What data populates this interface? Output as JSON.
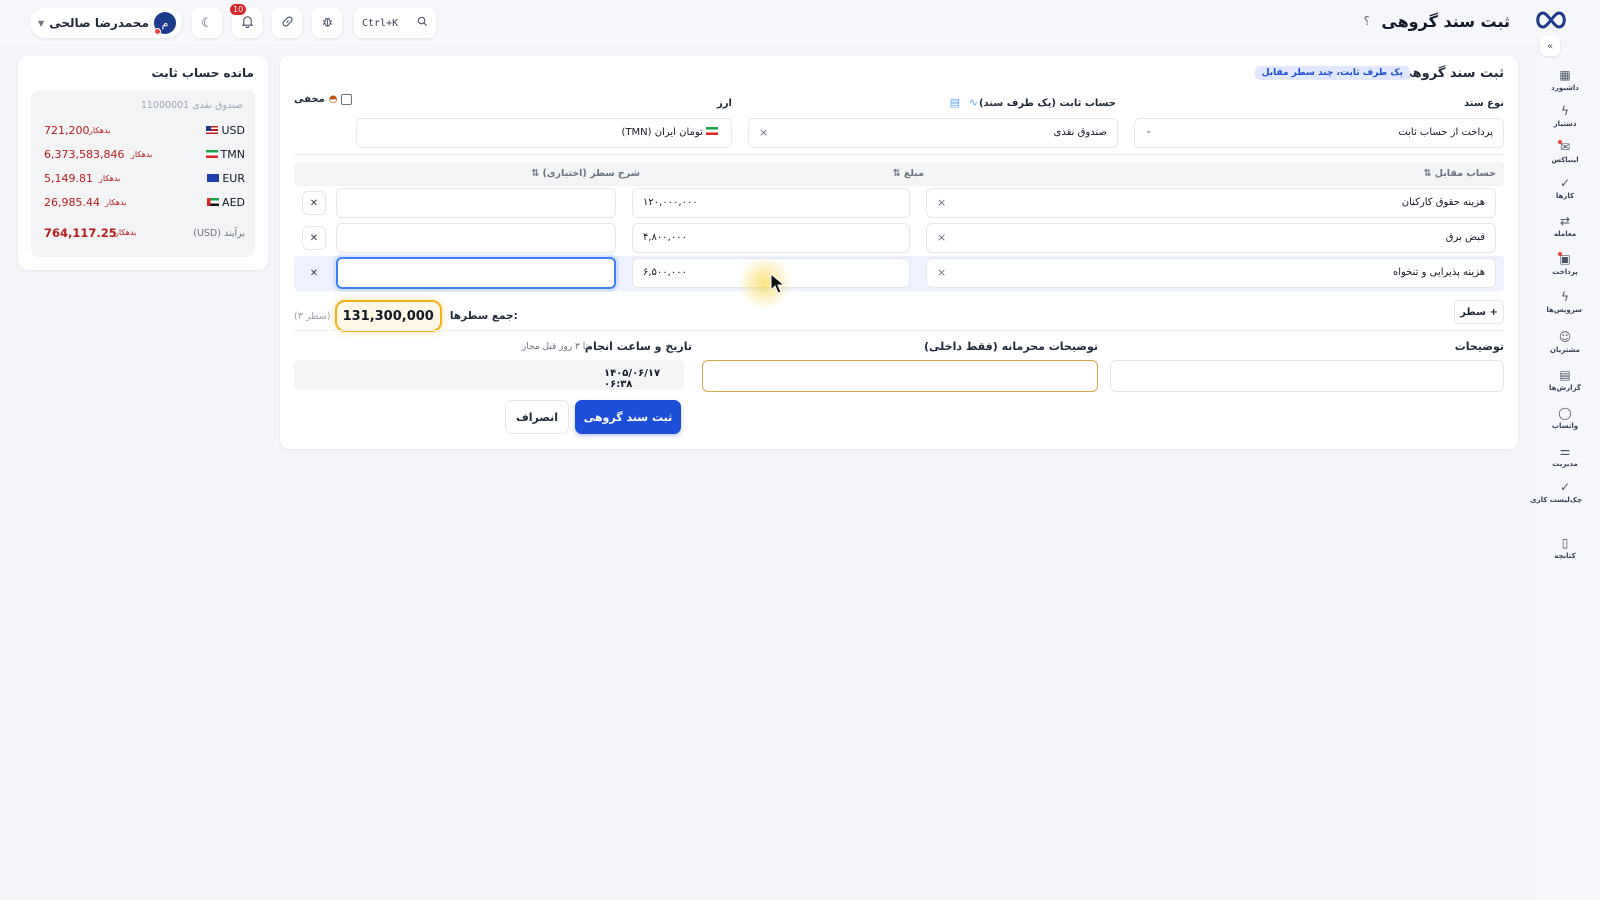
{
  "header": {
    "page_title": "ثبت سند گروهی",
    "help": "؟",
    "user_name": "محمدرضا صالحی",
    "avatar_letter": "م",
    "notification_count": "10",
    "search_shortcut": "Ctrl+K",
    "icons": [
      "moon-icon",
      "bell-icon",
      "link-icon",
      "bug-icon",
      "search-icon"
    ]
  },
  "sidebar": {
    "collapse": "«",
    "items": [
      {
        "label": "داشبورد",
        "icon": "grid-icon",
        "glyph": "▦"
      },
      {
        "label": "دستیار",
        "icon": "bolt-icon",
        "glyph": "ϟ"
      },
      {
        "label": "اینباکس",
        "icon": "inbox-icon",
        "glyph": "✉"
      },
      {
        "label": "کارها",
        "icon": "check-icon",
        "glyph": "✓"
      },
      {
        "label": "معامله",
        "icon": "swap-icon",
        "glyph": "⇄"
      },
      {
        "label": "پرداخت",
        "icon": "wallet-icon",
        "glyph": "▣"
      },
      {
        "label": "سرویس‌ها",
        "icon": "bolt-icon",
        "glyph": "ϟ"
      },
      {
        "label": "مشتریان",
        "icon": "users-icon",
        "glyph": "☺"
      },
      {
        "label": "گزارش‌ها",
        "icon": "report-icon",
        "glyph": "▤"
      },
      {
        "label": "واتساپ",
        "icon": "chat-icon",
        "glyph": "◯"
      },
      {
        "label": "مدیریت",
        "icon": "sliders-icon",
        "glyph": "⚌"
      },
      {
        "label": "چک‌لیست کاری",
        "icon": "check-icon",
        "glyph": "✓"
      },
      {
        "label": "کتابچه",
        "icon": "book-icon",
        "glyph": "▯"
      }
    ]
  },
  "balance": {
    "title": "مانده حساب ثابت",
    "account": "صندوق نقدی 11000001",
    "direction_label": "بدهکار",
    "rows": [
      {
        "currency": "USD",
        "amount": "721,200"
      },
      {
        "currency": "TMN",
        "amount": "6,373,583,846"
      },
      {
        "currency": "EUR",
        "amount": "5,149.81"
      },
      {
        "currency": "AED",
        "amount": "26,985.44"
      }
    ],
    "total_label": "برآیند (USD)",
    "total_amount": "764,117.25"
  },
  "form": {
    "title": "ثبت سند گروهی",
    "tag": "یک طرف ثابت، چند سطر مقابل",
    "doc_type_label": "نوع سند",
    "doc_type_value": "پرداخت از حساب ثابت",
    "fixed_account_label": "حساب ثابت (یک طرف سند)",
    "fixed_account_value": "صندوق نقدی",
    "currency_label": "ارز",
    "currency_value": "تومان ایران (TMN)",
    "hidden_label": "مخفی",
    "columns": {
      "counter_account": "حساب مقابل ⇅",
      "amount": "مبلغ ⇅",
      "line_desc": "شرح سطر (اختیاری) ⇅"
    },
    "rows": [
      {
        "account": "هزینه حقوق کارکنان",
        "amount": "۱۲۰,۰۰۰,۰۰۰",
        "desc": ""
      },
      {
        "account": "قبض برق",
        "amount": "۴,۸۰۰,۰۰۰",
        "desc": ""
      },
      {
        "account": "هزینه پذیرایی و تنخواه",
        "amount": "۶,۵۰۰,۰۰۰",
        "desc": ""
      }
    ],
    "add_row": "+ سطر",
    "sum_label": "جمع سطرها:",
    "sum_value": "131,300,000",
    "sum_count": "(۳ سطر)",
    "desc_label": "توضیحات",
    "private_desc_label": "توضیحات محرمانه (فقط داخلی)",
    "datetime_label": "تاریخ و ساعت انجام",
    "datetime_hint": "تا ۳ روز قبل مجاز",
    "datetime_value": "۱۴۰۵/۰۶/۱۷ ۰۶:۳۸",
    "submit": "ثبت سند گروهی",
    "cancel": "انصراف"
  },
  "colors": {
    "primary": "#1d4ed8",
    "debit": "#b91c1c",
    "highlight": "#f5b014"
  }
}
